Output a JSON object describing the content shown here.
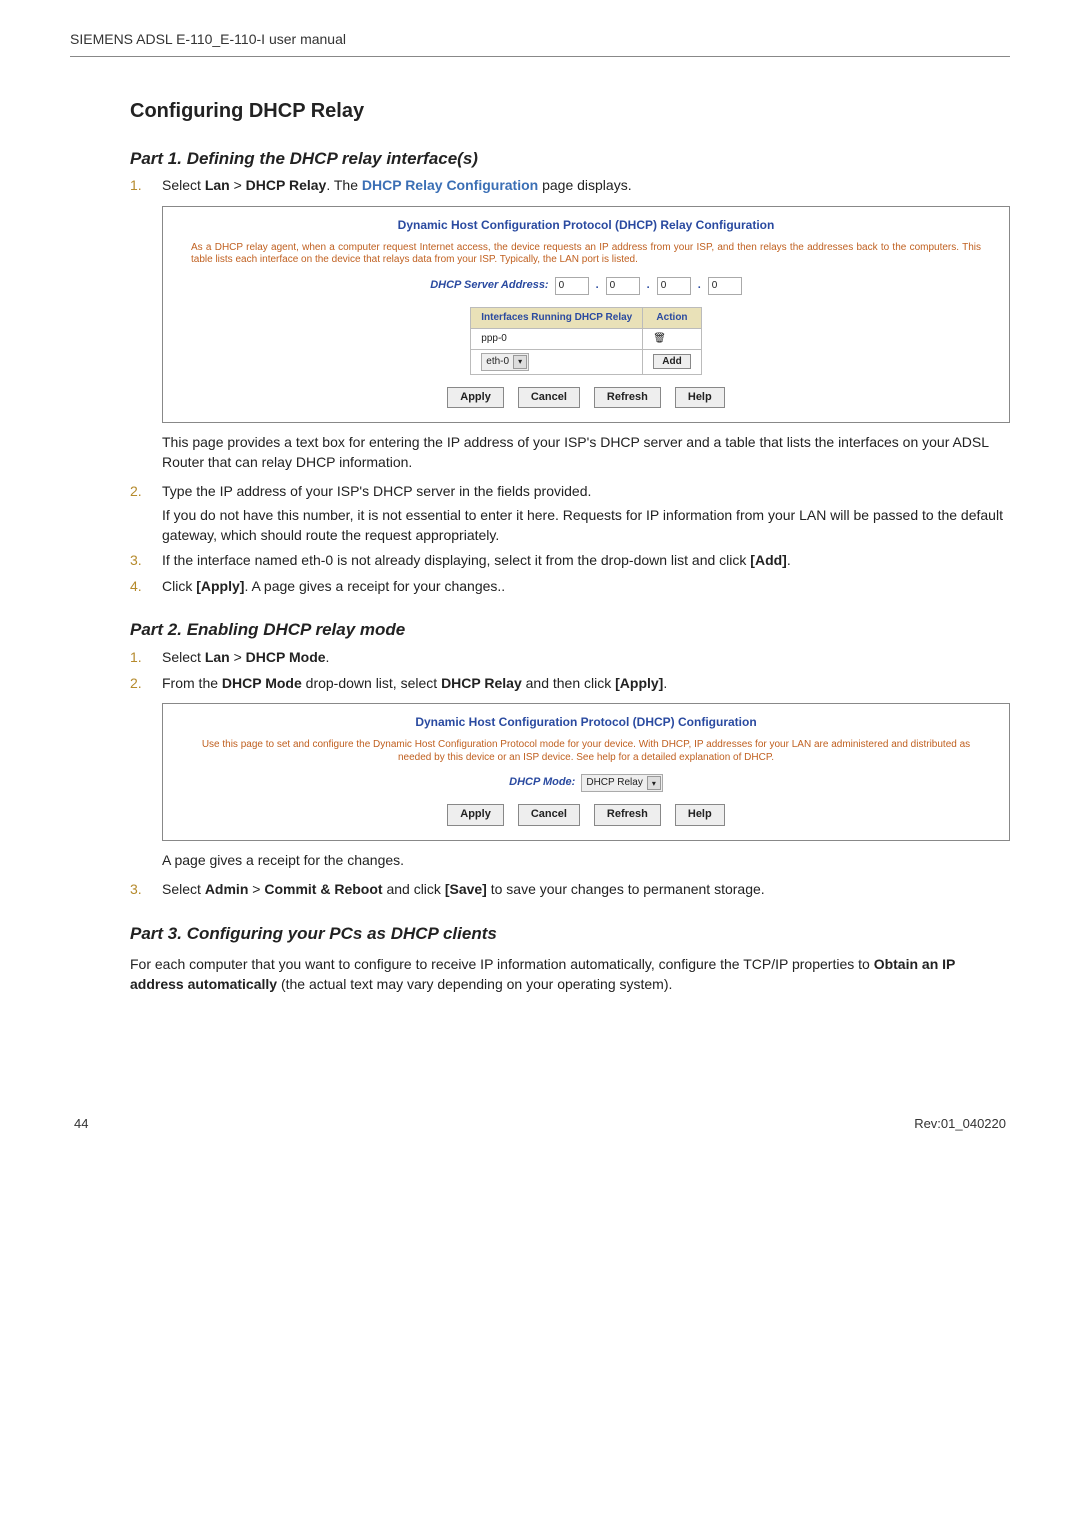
{
  "header": {
    "title": "SIEMENS ADSL E-110_E-110-I user manual"
  },
  "section_title": "Configuring DHCP Relay",
  "part1": {
    "heading": "Part 1. Defining the DHCP relay interface(s)",
    "step1_num": "1.",
    "step1_pre": "Select ",
    "step1_lan": "Lan",
    "step1_gt": " > ",
    "step1_dhcp": "DHCP Relay",
    "step1_mid": ". The ",
    "step1_link": "DHCP Relay Configuration",
    "step1_post": " page displays.",
    "fig": {
      "title": "Dynamic Host Configuration Protocol (DHCP) Relay Configuration",
      "desc": "As a DHCP relay agent, when a computer request Internet access, the device requests an IP address from your ISP, and then relays the addresses back to the computers. This table lists each interface on the device that relays data from your ISP. Typically, the LAN port is listed.",
      "server_label": "DHCP Server Address:",
      "ip": [
        "0",
        "0",
        "0",
        "0"
      ],
      "th_iface": "Interfaces Running DHCP Relay",
      "th_action": "Action",
      "row1_iface": "ppp-0",
      "row2_iface": "eth-0",
      "btn_add": "Add",
      "btn_apply": "Apply",
      "btn_cancel": "Cancel",
      "btn_refresh": "Refresh",
      "btn_help": "Help"
    },
    "after_fig": "This page provides a text box for entering the IP address of your ISP's DHCP server and a table that lists the interfaces on your ADSL Router that can relay DHCP information.",
    "step2_num": "2.",
    "step2_text": "Type the IP address of your ISP's DHCP server in the fields provided.",
    "step2_cont": "If you do not have this number, it is not essential to enter it here. Requests for IP information from your LAN will be passed to the default gateway, which should route the request appropriately.",
    "step3_num": "3.",
    "step3_pre": "If the interface named eth-0 is not already displaying, select it from the drop-down list and click ",
    "step3_bold": "[Add]",
    "step3_post": ".",
    "step4_num": "4.",
    "step4_pre": "Click ",
    "step4_bold": "[Apply]",
    "step4_post": ". A page gives a receipt for your changes.."
  },
  "part2": {
    "heading": "Part 2. Enabling DHCP relay mode",
    "step1_num": "1.",
    "step1_pre": "Select ",
    "step1_lan": "Lan",
    "step1_gt": " > ",
    "step1_mode": "DHCP Mode",
    "step1_post": ".",
    "step2_num": "2.",
    "step2_pre": "From the ",
    "step2_b1": "DHCP Mode",
    "step2_mid1": " drop-down list, select ",
    "step2_b2": "DHCP Relay",
    "step2_mid2": " and then click ",
    "step2_b3": "[Apply]",
    "step2_post": ".",
    "fig": {
      "title": "Dynamic Host Configuration Protocol (DHCP) Configuration",
      "desc": "Use this page to set and configure the Dynamic Host Configuration Protocol mode for your device. With DHCP, IP addresses for your LAN are administered and distributed as needed by this device or an ISP device. See help for a detailed explanation of DHCP.",
      "mode_label": "DHCP Mode:",
      "mode_value": "DHCP Relay",
      "btn_apply": "Apply",
      "btn_cancel": "Cancel",
      "btn_refresh": "Refresh",
      "btn_help": "Help"
    },
    "after_fig": "A page gives a receipt for the changes.",
    "step3_num": "3.",
    "step3_pre": "Select ",
    "step3_b1": "Admin",
    "step3_gt": " > ",
    "step3_b2": "Commit & Reboot",
    "step3_mid": " and click ",
    "step3_b3": "[Save]",
    "step3_post": " to save your changes to permanent storage."
  },
  "part3": {
    "heading": "Part 3. Configuring your PCs as DHCP clients",
    "para_pre": "For each computer that you want to configure to receive IP information automatically, configure the TCP/IP properties to ",
    "para_bold": "Obtain an IP address automatically",
    "para_post": " (the actual text may vary depending on your operating system)."
  },
  "footer": {
    "left": "44",
    "right": "Rev:01_040220"
  },
  "icons": {
    "trash": "🗑"
  }
}
